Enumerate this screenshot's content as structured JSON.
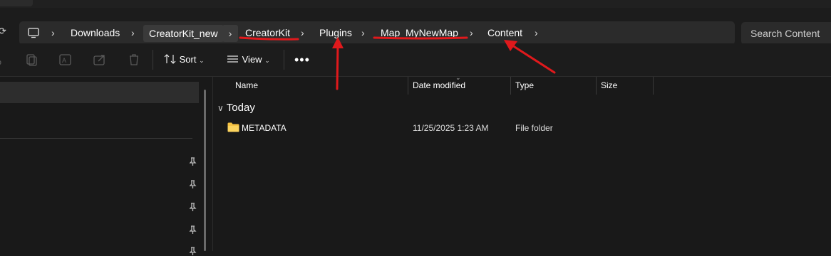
{
  "window": {
    "tab_title": ""
  },
  "address_bar": {
    "root_icon": "monitor-icon",
    "crumbs": [
      "Downloads",
      "CreatorKit_new",
      "CreatorKit",
      "Plugins",
      "Map_MyNewMap",
      "Content"
    ],
    "separator_icon": "chevron-right-icon"
  },
  "search": {
    "placeholder": "Search Content"
  },
  "toolbar": {
    "icons": [
      "cut-icon",
      "copy-icon",
      "rename-icon",
      "share-icon",
      "delete-icon"
    ],
    "sort_label": "Sort",
    "view_label": "View",
    "more_icon": "ellipsis-icon"
  },
  "sidebar": {
    "pinned_icons": [
      "pin-icon",
      "pin-icon",
      "pin-icon",
      "pin-icon",
      "pin-icon"
    ]
  },
  "file_list": {
    "columns": [
      "Name",
      "Date modified",
      "Type",
      "Size"
    ],
    "groups": [
      {
        "label": "Today",
        "items": [
          {
            "name": "METADATA",
            "date": "11/25/2025 1:23 AM",
            "type": "File folder",
            "size": ""
          }
        ]
      }
    ]
  },
  "annotations": {
    "color": "#e0191c",
    "underlined_crumbs": [
      "CreatorKit",
      "Map_MyNewMap"
    ],
    "arrows_to": [
      "Plugins",
      "Content"
    ]
  }
}
